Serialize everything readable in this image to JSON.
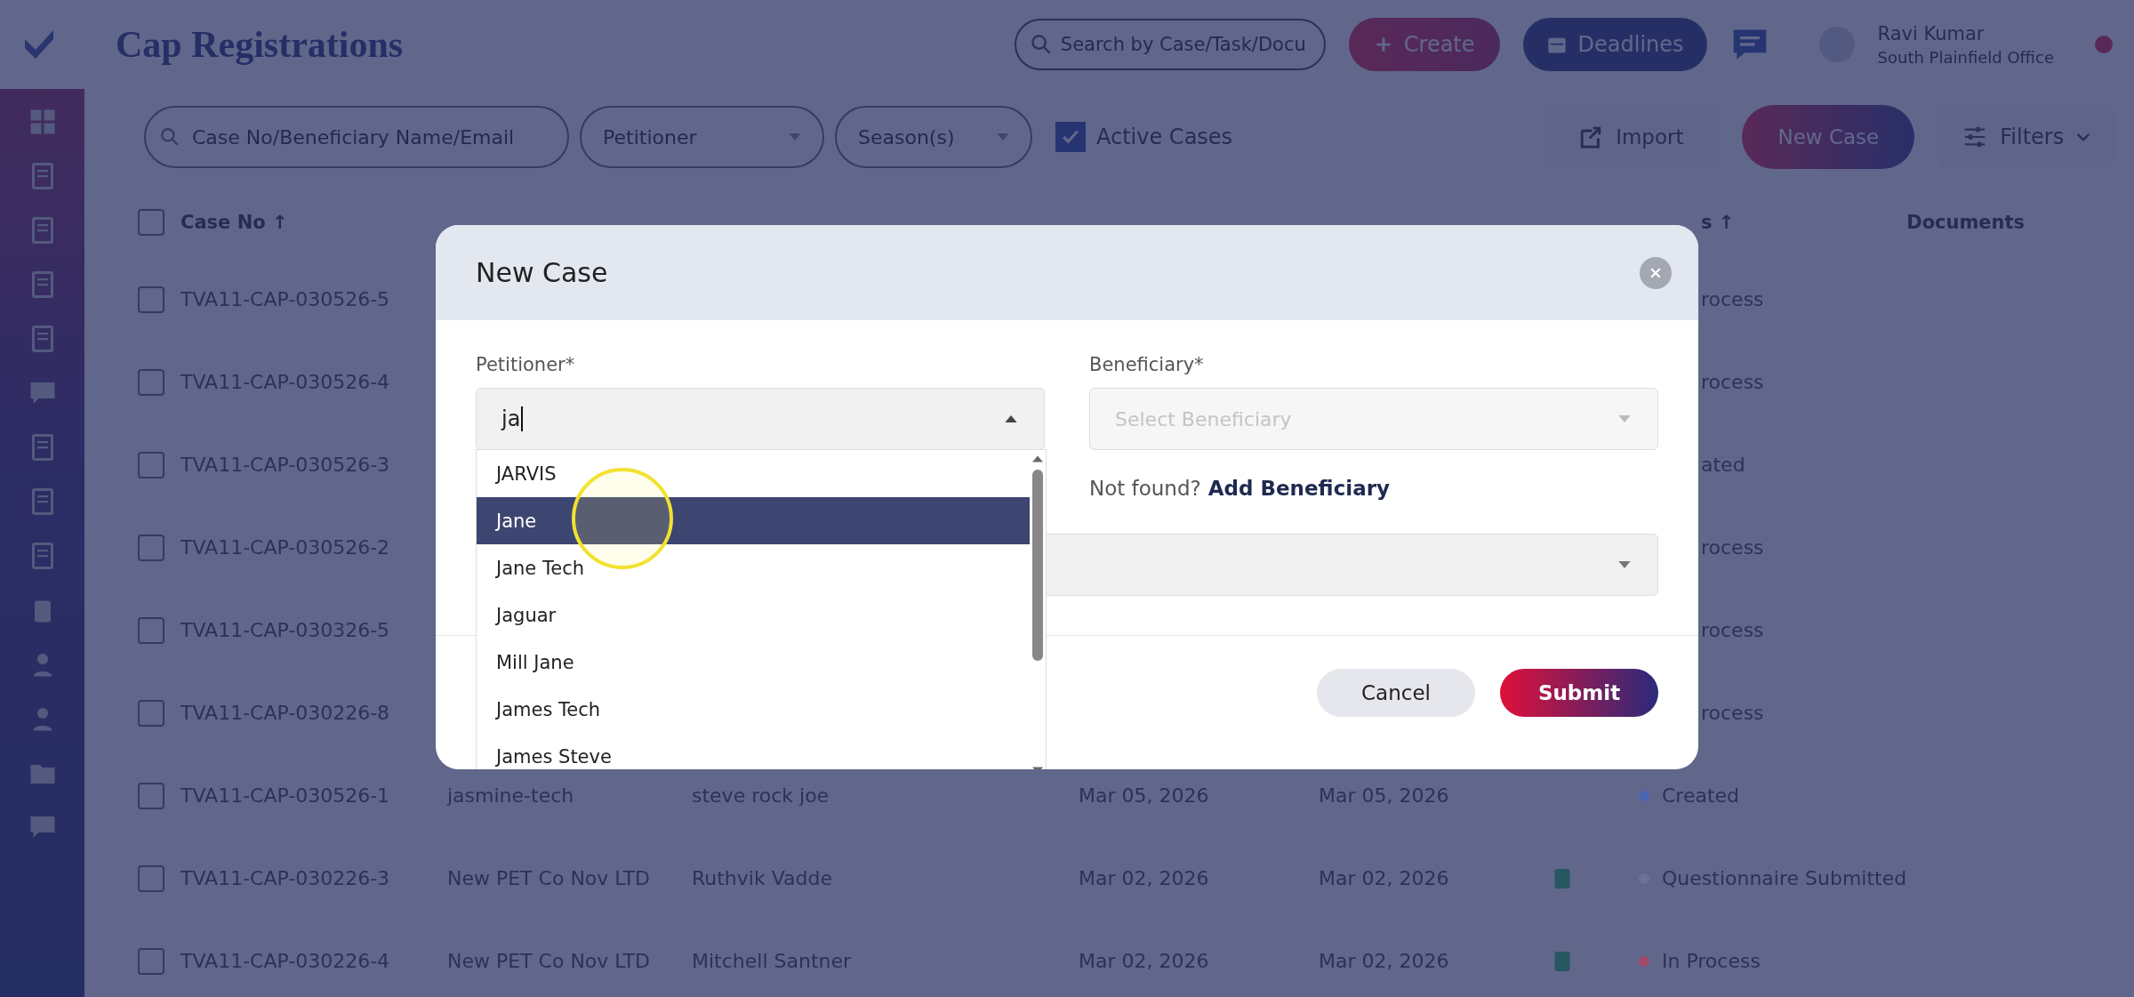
{
  "topbar": {
    "title": "Cap Registrations",
    "search": {
      "placeholder": "Search by Case/Task/Docu"
    },
    "create_button": "Create",
    "deadlines_button": "Deadlines",
    "user": {
      "name": "Ravi Kumar",
      "office": "South Plainfield Office"
    }
  },
  "filters": {
    "search": {
      "placeholder": "Case No/Beneficiary Name/Email"
    },
    "petitioner": {
      "placeholder": "Petitioner"
    },
    "season": {
      "placeholder": "Season(s)"
    },
    "active_cases": {
      "label": "Active Cases",
      "checked": true
    },
    "import_button": "Import",
    "new_case_button": "New Case",
    "filters_button": "Filters"
  },
  "table": {
    "header": {
      "checked": false,
      "case_no": "Case No ↑",
      "status": "s ↑",
      "documents": "Documents"
    },
    "rows": [
      {
        "case_no": "TVA11-CAP-030526-5",
        "status": "rocess",
        "checked": false
      },
      {
        "case_no": "TVA11-CAP-030526-4",
        "status": "rocess",
        "checked": false
      },
      {
        "case_no": "TVA11-CAP-030526-3",
        "status": "ated",
        "checked": false
      },
      {
        "case_no": "TVA11-CAP-030526-2",
        "status": "rocess",
        "checked": false
      },
      {
        "case_no": "TVA11-CAP-030326-5",
        "status": "rocess",
        "checked": false
      },
      {
        "case_no": "TVA11-CAP-030226-8",
        "status": "rocess",
        "checked": false
      },
      {
        "case_no": "TVA11-CAP-030526-1",
        "petitioner": "jasmine-tech",
        "beneficiary": "steve rock joe",
        "created": "Mar 05, 2026",
        "date_2": "Mar 05, 2026",
        "doc_flag": false,
        "status": "Created",
        "color": "#4a64b0",
        "checked": false
      },
      {
        "case_no": "TVA11-CAP-030226-3",
        "petitioner": "New PET Co Nov LTD",
        "beneficiary": "Ruthvik Vadde",
        "created": "Mar 02, 2026",
        "date_2": "Mar 02, 2026",
        "doc_flag": true,
        "status": "Questionnaire Submitted",
        "color": "#6b7396",
        "checked": false
      },
      {
        "case_no": "TVA11-CAP-030226-4",
        "petitioner": "New PET Co Nov LTD",
        "beneficiary": "Mitchell Santner",
        "created": "Mar 02, 2026",
        "date_2": "Mar 02, 2026",
        "doc_flag": true,
        "status": "In Process",
        "color": "#a04a6a",
        "checked": false
      }
    ]
  },
  "modal": {
    "title": "New Case",
    "petitioner": {
      "label": "Petitioner*",
      "value": "ja",
      "expanded": true
    },
    "beneficiary": {
      "label": "Beneficiary*",
      "placeholder": "Select Beneficiary",
      "disabled": true
    },
    "not_found": "Not found?",
    "add_link": "Add Beneficiary",
    "options": [
      {
        "label": "JARVIS",
        "selected": false
      },
      {
        "label": "Jane",
        "selected": true
      },
      {
        "label": "Jane Tech",
        "selected": false
      },
      {
        "label": "Jaguar",
        "selected": false
      },
      {
        "label": "Mill Jane",
        "selected": false
      },
      {
        "label": "James Tech",
        "selected": false
      },
      {
        "label": "James Steve",
        "selected": false
      }
    ],
    "cancel_button": "Cancel",
    "submit_button": "Submit"
  }
}
